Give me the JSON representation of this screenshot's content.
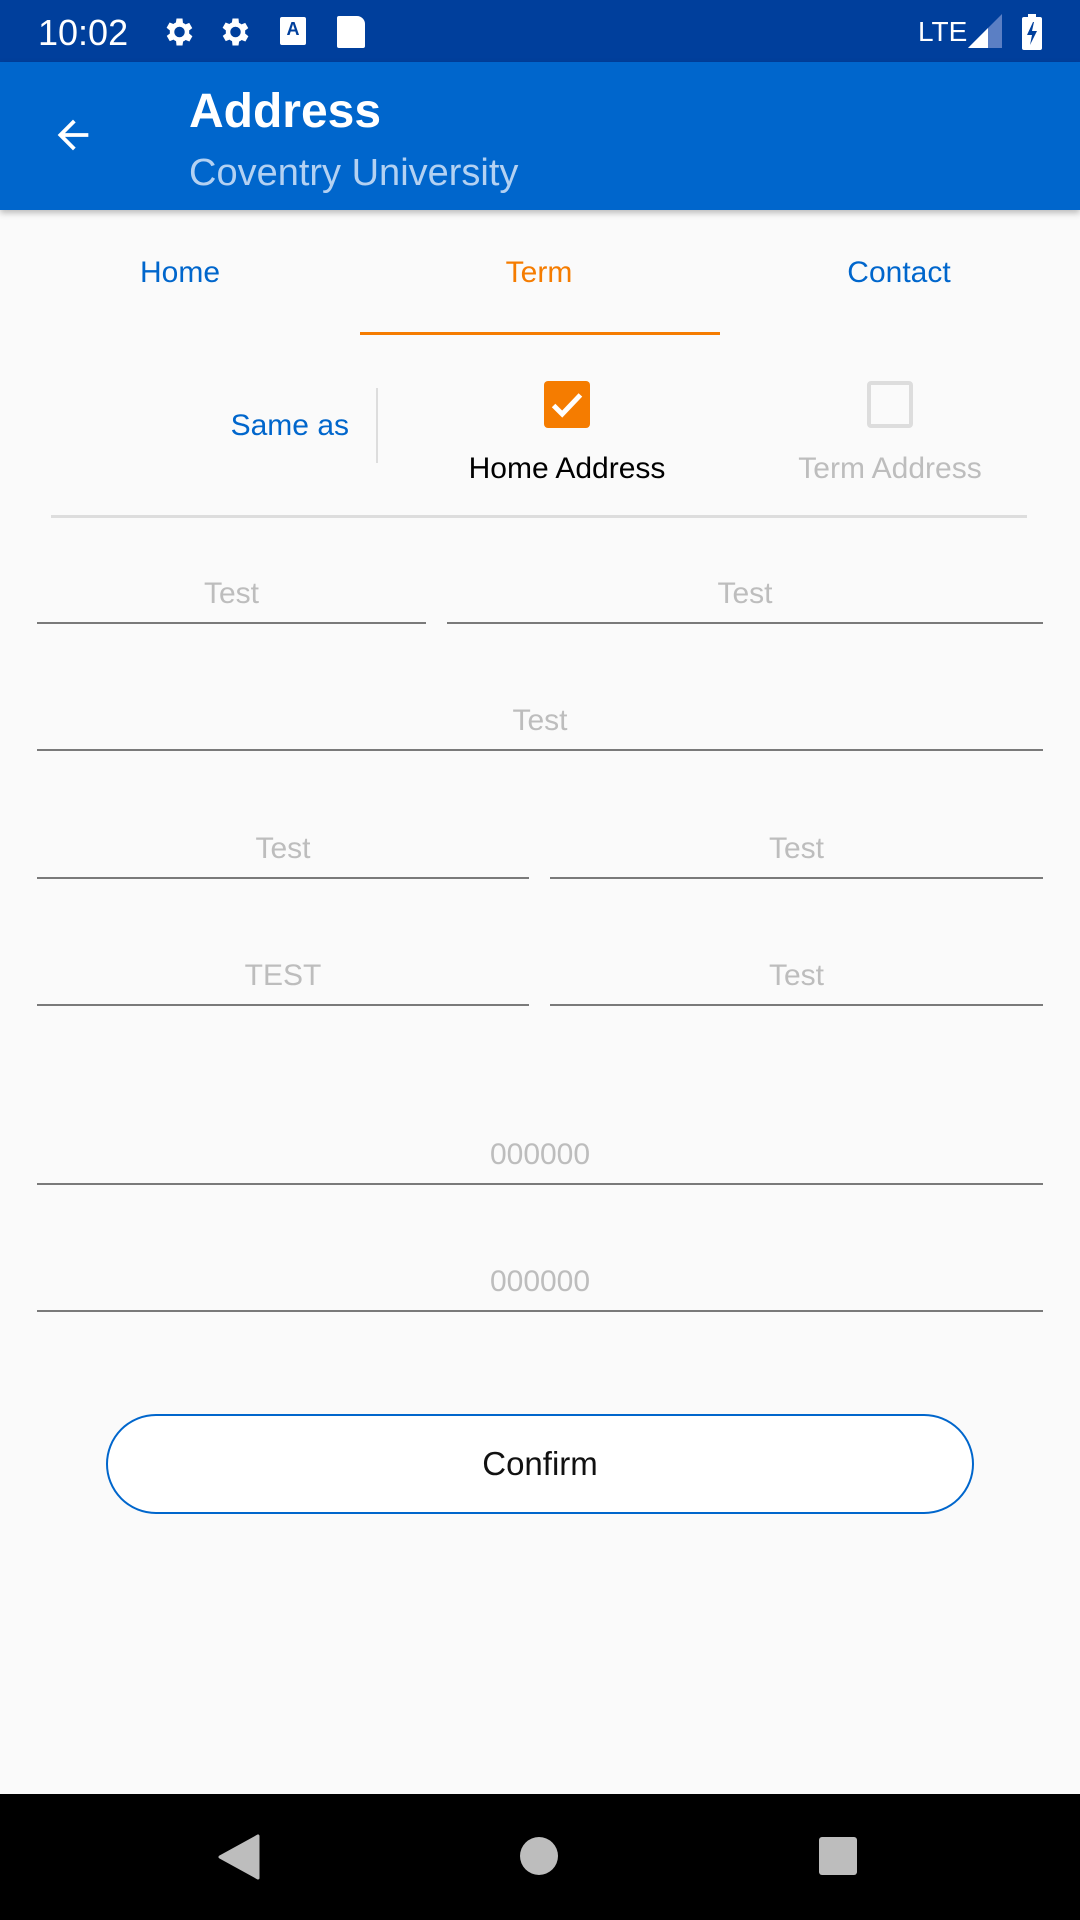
{
  "status_bar": {
    "time": "10:02",
    "network": "LTE",
    "icons": [
      "gear-icon",
      "gear-icon",
      "a-notification-icon",
      "sd-card-icon",
      "signal-icon",
      "battery-charging-icon"
    ]
  },
  "app_bar": {
    "title": "Address",
    "subtitle": "Coventry University",
    "back_icon": "arrow-left-icon"
  },
  "tabs": [
    {
      "label": "Home",
      "selected": false
    },
    {
      "label": "Term",
      "selected": true
    },
    {
      "label": "Contact",
      "selected": false
    }
  ],
  "same_as": {
    "label": "Same as",
    "options": [
      {
        "label": "Home Address",
        "checked": true
      },
      {
        "label": "Term Address",
        "checked": false
      }
    ]
  },
  "fields": [
    {
      "value": "Test"
    },
    {
      "value": "Test"
    },
    {
      "value": "Test"
    },
    {
      "value": "Test"
    },
    {
      "value": "Test"
    },
    {
      "value": "TEST"
    },
    {
      "value": "Test"
    },
    {
      "value": "000000"
    },
    {
      "value": "000000"
    }
  ],
  "confirm_label": "Confirm",
  "colors": {
    "primary": "#0066cc",
    "status_bar": "#003f9c",
    "accent": "#f57c00",
    "hint": "#bdbdbd"
  }
}
